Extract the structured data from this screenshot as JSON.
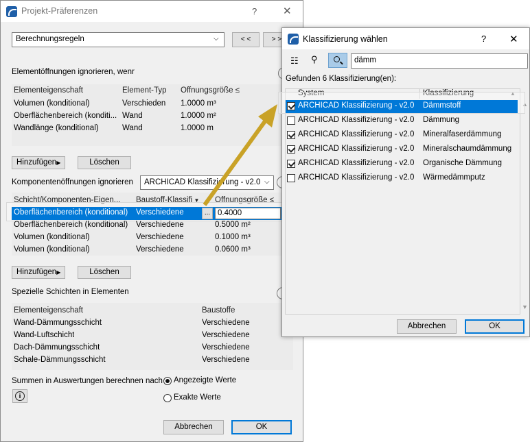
{
  "pref": {
    "title": "Projekt-Präferenzen",
    "help": "?",
    "close": "✕",
    "category": "Berechnungsregeln",
    "prev": "< <",
    "next": "> >",
    "sec1_title": "Elementöffnungen ignorieren, wenr",
    "sec1_headers": [
      "Elementeigenschaft",
      "Element-Typ",
      "Öffnungsgröße ≤"
    ],
    "sec1_rows": [
      [
        "Volumen (konditional)",
        "Verschieden",
        "1.0000 m³"
      ],
      [
        "Oberflächenbereich (konditi...",
        "Wand",
        "1.0000 m²"
      ],
      [
        "Wandlänge (konditional)",
        "Wand",
        "1.0000 m"
      ]
    ],
    "add": "Hinzufügen",
    "delete": "Löschen",
    "sec2_label": "Komponentenöffnungen ignorieren",
    "sec2_select": "ARCHICAD Klassifizierung - v2.0",
    "sec2_headers": [
      "Schicht/Komponenten-Eigen...",
      "Baustoff-Klassifi",
      "Öffnungsgröße ≤"
    ],
    "sec2_selected": [
      "Oberflächenbereich (konditional)",
      "Verschiedene",
      "...",
      "0.4000"
    ],
    "sec2_rows": [
      [
        "Oberflächenbereich (konditional)",
        "Verschiedene",
        "0.5000 m²"
      ],
      [
        "Volumen (konditional)",
        "Verschiedene",
        "0.1000 m³"
      ],
      [
        "Volumen (konditional)",
        "Verschiedene",
        "0.0600 m³"
      ]
    ],
    "sec3_title": "Spezielle Schichten in Elementen",
    "sec3_headers": [
      "Elementeigenschaft",
      "Baustoffe"
    ],
    "sec3_rows": [
      [
        "Wand-Dämmungsschicht",
        "Verschiedene"
      ],
      [
        "Wand-Luftschicht",
        "Verschiedene"
      ],
      [
        "Dach-Dämmungsschicht",
        "Verschiedene"
      ],
      [
        "Schale-Dämmungsschicht",
        "Verschiedene"
      ]
    ],
    "sum_label": "Summen in Auswertungen berechnen nach",
    "radio1": "Angezeigte Werte",
    "radio2": "Exakte Werte",
    "info": "i",
    "cancel": "Abbrechen",
    "ok": "OK"
  },
  "klass": {
    "title": "Klassifizierung wählen",
    "help": "?",
    "close": "✕",
    "search_value": "dämm",
    "found": "Gefunden 6 Klassifizierung(en):",
    "col_system": "System",
    "col_class": "Klassifizierung",
    "rows": [
      {
        "checked": true,
        "system": "ARCHICAD Klassifizierung - v2.0",
        "class": "Dämmstoff",
        "selected": true
      },
      {
        "checked": false,
        "system": "ARCHICAD Klassifizierung - v2.0",
        "class": "Dämmung",
        "selected": false
      },
      {
        "checked": true,
        "system": "ARCHICAD Klassifizierung - v2.0",
        "class": "Mineralfaserdämmung",
        "selected": false
      },
      {
        "checked": true,
        "system": "ARCHICAD Klassifizierung - v2.0",
        "class": "Mineralschaumdämmung",
        "selected": false
      },
      {
        "checked": true,
        "system": "ARCHICAD Klassifizierung - v2.0",
        "class": "Organische Dämmung",
        "selected": false
      },
      {
        "checked": false,
        "system": "ARCHICAD Klassifizierung - v2.0",
        "class": "Wärmedämmputz",
        "selected": false
      }
    ],
    "cancel": "Abbrechen",
    "ok": "OK"
  },
  "colors": {
    "selection": "#0078d7",
    "arrow": "#c9a227",
    "window_bg": "#f0f0f0"
  }
}
